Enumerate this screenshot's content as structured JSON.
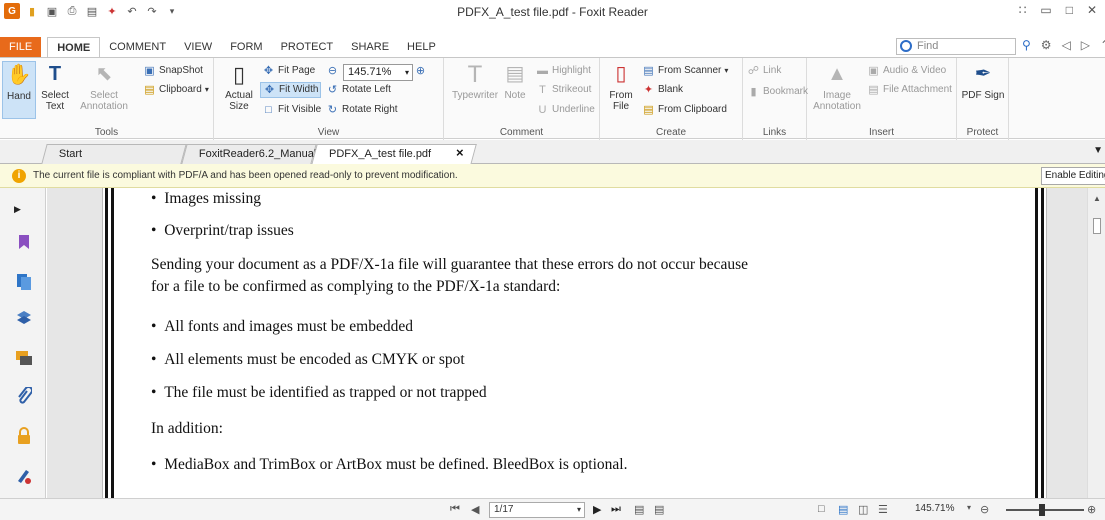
{
  "window": {
    "title": "PDFX_A_test file.pdf - Foxit Reader",
    "app_logo": "G"
  },
  "ribbon_tabs": [
    "FILE",
    "HOME",
    "COMMENT",
    "VIEW",
    "FORM",
    "PROTECT",
    "SHARE",
    "HELP"
  ],
  "find": {
    "placeholder": "Find"
  },
  "tools_group": {
    "label": "Tools",
    "hand": "Hand",
    "select_text": "Select Text",
    "select_annotation": "Select Annotation",
    "snapshot": "SnapShot",
    "clipboard": "Clipboard"
  },
  "view_group": {
    "label": "View",
    "actual_size": "Actual Size",
    "fit_page": "Fit Page",
    "fit_width": "Fit Width",
    "fit_visible": "Fit Visible",
    "zoom": "145.71%",
    "rotate_left": "Rotate Left",
    "rotate_right": "Rotate Right"
  },
  "comment_group": {
    "label": "Comment",
    "typewriter": "Typewriter",
    "note": "Note",
    "highlight": "Highlight",
    "strikeout": "Strikeout",
    "underline": "Underline"
  },
  "create_group": {
    "label": "Create",
    "from_file": "From File",
    "from_scanner": "From Scanner",
    "blank": "Blank",
    "from_clipboard": "From Clipboard"
  },
  "links_group": {
    "label": "Links",
    "link": "Link",
    "bookmark": "Bookmark"
  },
  "insert_group": {
    "label": "Insert",
    "image_annotation": "Image Annotation",
    "audio_video": "Audio & Video",
    "file_attachment": "File Attachment"
  },
  "protect_group": {
    "label": "Protect",
    "pdf_sign": "PDF Sign"
  },
  "doc_tabs": [
    "Start",
    "FoxitReader6.2_Manual...",
    "PDFX_A_test file.pdf"
  ],
  "notice": {
    "text": "The current file is compliant with PDF/A and has been opened read-only to prevent modification.",
    "button": "Enable Editing"
  },
  "document": {
    "bullets_top": [
      "Images missing",
      "Overprint/trap issues"
    ],
    "para1_line1": "Sending your document as a PDF/X-1a file will guarantee that these errors do not occur because",
    "para1_line2": "for a file to be confirmed as complying to the PDF/X-1a standard:",
    "bullets_mid": [
      "All fonts and images must be embedded",
      "All elements must be encoded as CMYK or spot",
      "The file must be identified as trapped or not trapped"
    ],
    "in_addition": "In addition:",
    "bullets_bottom": [
      "MediaBox and TrimBox or ArtBox must be defined. BleedBox is optional."
    ]
  },
  "statusbar": {
    "page": "1/17",
    "zoom": "145.71%"
  }
}
